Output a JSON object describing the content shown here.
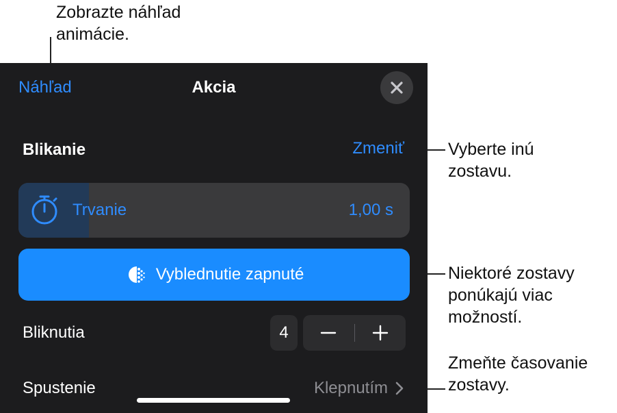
{
  "callouts": {
    "preview": [
      "Zobrazte náhľad",
      "animácie."
    ],
    "change": [
      "Vyberte inú",
      "zostavu."
    ],
    "options": [
      "Niektoré zostavy",
      "ponúkajú viac",
      "možností."
    ],
    "timing": [
      "Zmeňte časovanie",
      "zostavy."
    ]
  },
  "nav": {
    "preview_label": "Náhľad",
    "title": "Akcia"
  },
  "effect": {
    "name": "Blikanie",
    "change_label": "Zmeniť"
  },
  "duration": {
    "label": "Trvanie",
    "value": "1,00 s",
    "fill_fraction": 0.18
  },
  "fade_button": {
    "label": "Vyblednutie zapnuté"
  },
  "blinks": {
    "label": "Bliknutia",
    "count": "4"
  },
  "start": {
    "label": "Spustenie",
    "value": "Klepnutím"
  },
  "colors": {
    "accent": "#2f8cff",
    "button": "#1a8cff",
    "panel": "#1c1c1e",
    "row": "#3a3a3c"
  }
}
